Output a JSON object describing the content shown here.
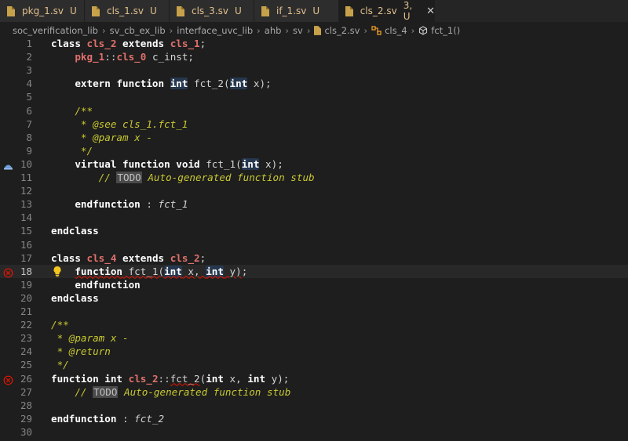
{
  "tabs": [
    {
      "label": "pkg_1.sv",
      "status": "U",
      "active": false
    },
    {
      "label": "cls_1.sv",
      "status": "U",
      "active": false
    },
    {
      "label": "cls_3.sv",
      "status": "U",
      "active": false
    },
    {
      "label": "if_1.sv",
      "status": "U",
      "active": false
    },
    {
      "label": "cls_2.sv",
      "status": "3, U",
      "active": true
    }
  ],
  "breadcrumb": [
    "soc_verification_lib",
    "sv_cb_ex_lib",
    "interface_uvc_lib",
    "ahb",
    "sv",
    "cls_2.sv",
    "cls_4",
    "fct_1()"
  ],
  "icons": {
    "tab_file": "systemverilog-file-icon",
    "class": "class-symbol-icon",
    "method": "method-symbol-icon",
    "breakpoint": "breakpoint-icon",
    "error": "error-icon",
    "lightbulb": "lightbulb-icon",
    "close": "close-icon"
  },
  "colors": {
    "background": "#1e1e1e",
    "modified_tab": "#e2c08d",
    "error": "#e51400",
    "keyword": "#ffffff",
    "class_name": "#e0706b",
    "comment": "#c8c832"
  },
  "editor": {
    "lines": [
      {
        "num": "1",
        "tokens": [
          {
            "t": "class",
            "c": "kw"
          },
          {
            "t": " "
          },
          {
            "t": "cls_2",
            "c": "cls"
          },
          {
            "t": " "
          },
          {
            "t": "extends",
            "c": "kw"
          },
          {
            "t": " "
          },
          {
            "t": "cls_1",
            "c": "cls"
          },
          {
            "t": ";"
          }
        ]
      },
      {
        "num": "2",
        "tokens": [
          {
            "t": "    "
          },
          {
            "t": "pkg_1",
            "c": "cls"
          },
          {
            "t": "::"
          },
          {
            "t": "cls_0",
            "c": "cls"
          },
          {
            "t": " c_inst;"
          }
        ]
      },
      {
        "num": "3",
        "tokens": []
      },
      {
        "num": "4",
        "tokens": [
          {
            "t": "    "
          },
          {
            "t": "extern",
            "c": "kw"
          },
          {
            "t": " "
          },
          {
            "t": "function",
            "c": "kw"
          },
          {
            "t": " "
          },
          {
            "t": "int",
            "c": "ty tyhl"
          },
          {
            "t": " fct_2("
          },
          {
            "t": "int",
            "c": "ty tyhl"
          },
          {
            "t": " x);"
          }
        ]
      },
      {
        "num": "5",
        "tokens": []
      },
      {
        "num": "6",
        "tokens": [
          {
            "t": "    /**",
            "c": "cm"
          }
        ]
      },
      {
        "num": "7",
        "tokens": [
          {
            "t": "     * @see cls_1.fct_1",
            "c": "cm"
          }
        ]
      },
      {
        "num": "8",
        "tokens": [
          {
            "t": "     * @param x -",
            "c": "cm"
          }
        ]
      },
      {
        "num": "9",
        "tokens": [
          {
            "t": "     */",
            "c": "cm"
          }
        ]
      },
      {
        "num": "10",
        "gutter": "breakpoint",
        "tokens": [
          {
            "t": "    "
          },
          {
            "t": "virtual",
            "c": "kw"
          },
          {
            "t": " "
          },
          {
            "t": "function",
            "c": "kw"
          },
          {
            "t": " "
          },
          {
            "t": "void",
            "c": "kw"
          },
          {
            "t": " fct_1("
          },
          {
            "t": "int",
            "c": "ty tyhl"
          },
          {
            "t": " x);"
          }
        ]
      },
      {
        "num": "11",
        "tokens": [
          {
            "t": "        // ",
            "c": "cm"
          },
          {
            "t": "TODO",
            "c": "cm todo"
          },
          {
            "t": " Auto-generated function stub",
            "c": "cm"
          }
        ]
      },
      {
        "num": "12",
        "tokens": []
      },
      {
        "num": "13",
        "tokens": [
          {
            "t": "    "
          },
          {
            "t": "endfunction",
            "c": "kw"
          },
          {
            "t": " : "
          },
          {
            "t": "fct_1",
            "c": "it"
          }
        ]
      },
      {
        "num": "14",
        "tokens": []
      },
      {
        "num": "15",
        "tokens": [
          {
            "t": "endclass",
            "c": "kw"
          }
        ]
      },
      {
        "num": "16",
        "tokens": []
      },
      {
        "num": "17",
        "tokens": [
          {
            "t": "class",
            "c": "kw"
          },
          {
            "t": " "
          },
          {
            "t": "cls_4",
            "c": "cls"
          },
          {
            "t": " "
          },
          {
            "t": "extends",
            "c": "kw"
          },
          {
            "t": " "
          },
          {
            "t": "cls_2",
            "c": "cls"
          },
          {
            "t": ";"
          }
        ]
      },
      {
        "num": "18",
        "gutter": "error",
        "current": true,
        "bulb": true,
        "tokens": [
          {
            "t": "    "
          },
          {
            "t": "function",
            "c": "kw squig"
          },
          {
            "t": " fct_1(",
            "c": "squig"
          },
          {
            "t": "int",
            "c": "ty tyhl squig"
          },
          {
            "t": " x, ",
            "c": "squig"
          },
          {
            "t": "int",
            "c": "ty tyhl squig"
          },
          {
            "t": " y)",
            "c": "squig"
          },
          {
            "t": ";"
          }
        ]
      },
      {
        "num": "19",
        "tokens": [
          {
            "t": "    "
          },
          {
            "t": "endfunction",
            "c": "kw"
          }
        ]
      },
      {
        "num": "20",
        "tokens": [
          {
            "t": "endclass",
            "c": "kw"
          }
        ]
      },
      {
        "num": "21",
        "tokens": []
      },
      {
        "num": "22",
        "tokens": [
          {
            "t": "/**",
            "c": "cm"
          }
        ]
      },
      {
        "num": "23",
        "tokens": [
          {
            "t": " * @param x -",
            "c": "cm"
          }
        ]
      },
      {
        "num": "24",
        "tokens": [
          {
            "t": " * @return",
            "c": "cm"
          }
        ]
      },
      {
        "num": "25",
        "tokens": [
          {
            "t": " */",
            "c": "cm"
          }
        ]
      },
      {
        "num": "26",
        "gutter": "error",
        "tokens": [
          {
            "t": "function",
            "c": "kw"
          },
          {
            "t": " "
          },
          {
            "t": "int",
            "c": "ty"
          },
          {
            "t": " "
          },
          {
            "t": "cls_2",
            "c": "cls"
          },
          {
            "t": "::"
          },
          {
            "t": "fct_2",
            "c": "squig"
          },
          {
            "t": "("
          },
          {
            "t": "int",
            "c": "ty"
          },
          {
            "t": " x, "
          },
          {
            "t": "int",
            "c": "ty"
          },
          {
            "t": " y);"
          }
        ]
      },
      {
        "num": "27",
        "tokens": [
          {
            "t": "    // ",
            "c": "cm"
          },
          {
            "t": "TODO",
            "c": "cm todo"
          },
          {
            "t": " Auto-generated function stub",
            "c": "cm"
          }
        ]
      },
      {
        "num": "28",
        "tokens": []
      },
      {
        "num": "29",
        "tokens": [
          {
            "t": "endfunction",
            "c": "kw"
          },
          {
            "t": " : "
          },
          {
            "t": "fct_2",
            "c": "it"
          }
        ]
      },
      {
        "num": "30",
        "tokens": []
      }
    ]
  }
}
